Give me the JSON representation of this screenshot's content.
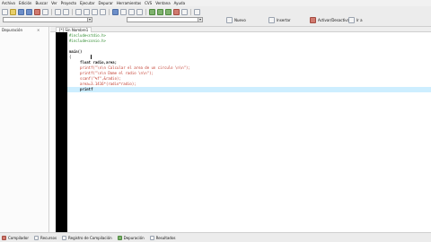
{
  "menu": [
    "Archivo",
    "Edición",
    "Buscar",
    "Ver",
    "Proyecto",
    "Ejecutar",
    "Depurar",
    "Herramientas",
    "CVS",
    "Ventana",
    "Ayuda"
  ],
  "toolbar": {
    "buttons": [
      {
        "label": "Nuevo",
        "icon": "new-project-icon"
      },
      {
        "label": "Insertar",
        "icon": "insert-icon"
      },
      {
        "label": "Activar/Desactivar",
        "icon": "toggle-breakpoint-icon"
      },
      {
        "label": "Ir a",
        "icon": "goto-icon"
      }
    ]
  },
  "sidebar": {
    "tab_label": "Depuración"
  },
  "tabs": [
    {
      "label": "[*] Sin Nombre1"
    }
  ],
  "editor": {
    "lines": [
      {
        "pp": "#include<stdio.h>"
      },
      {
        "pp": "#include<conio.h>"
      },
      {
        "code": ""
      },
      {
        "code": "main()"
      },
      {
        "code": "{"
      },
      {
        "code": "     float radio,area;"
      },
      {
        "code": "     printf(\"\\n\\n Calcular el area de un circulo \\n\\n\");"
      },
      {
        "code": "     printf(\"\\n\\n Dame el radio \\n\\n\");"
      },
      {
        "code": "     scanf(\"%f\",&radio);"
      },
      {
        "code": "     area=3.1416*(radio*radio);"
      },
      {
        "code": "     printf"
      }
    ]
  },
  "status": [
    {
      "label": "Compilador",
      "icon": "compiler-icon"
    },
    {
      "label": "Recursos",
      "icon": "resources-icon"
    },
    {
      "label": "Registro de Compilación",
      "icon": "compile-log-icon"
    },
    {
      "label": "Depuración",
      "icon": "debug-icon"
    },
    {
      "label": "Resultados",
      "icon": "results-icon"
    }
  ]
}
